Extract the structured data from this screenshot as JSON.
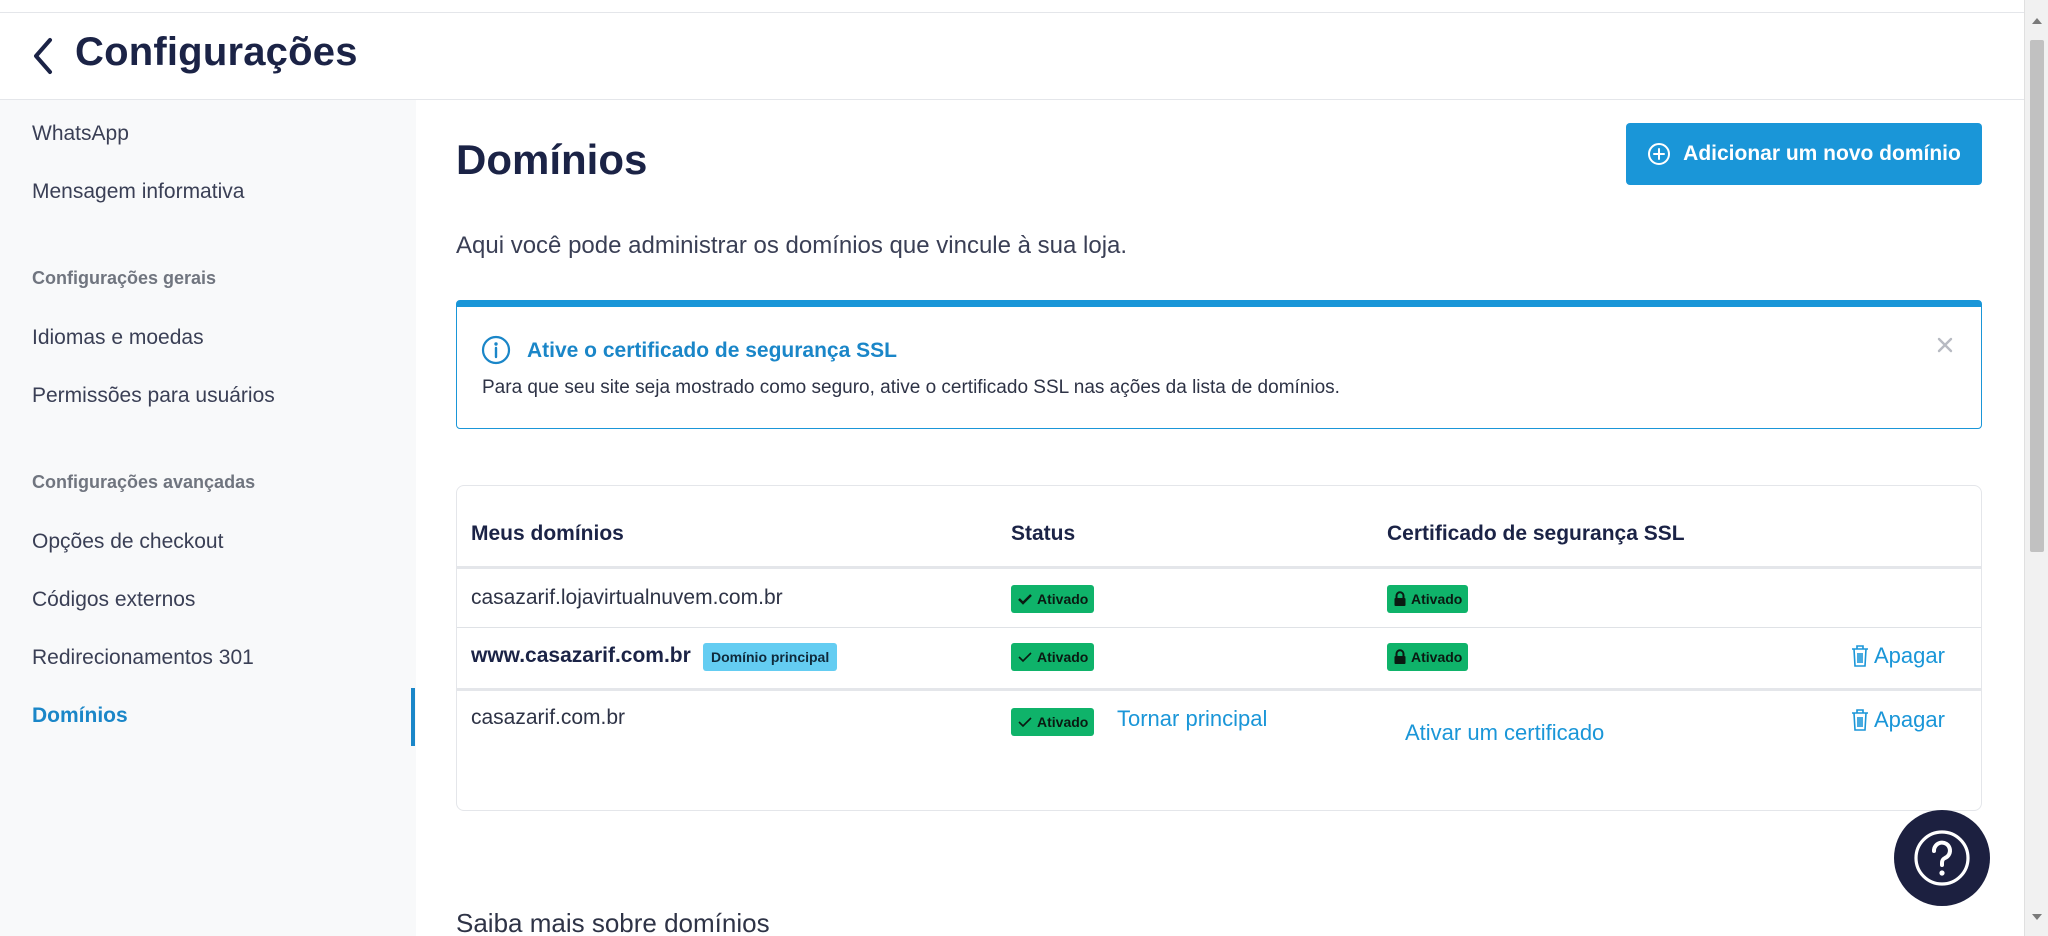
{
  "header": {
    "title": "Configurações",
    "back_icon": "chevron-left-icon"
  },
  "sidebar": {
    "items_top": [
      {
        "label": "WhatsApp"
      },
      {
        "label": "Mensagem informativa"
      }
    ],
    "section_general": "Configurações gerais",
    "items_general": [
      {
        "label": "Idiomas e moedas"
      },
      {
        "label": "Permissões para usuários"
      }
    ],
    "section_advanced": "Configurações avançadas",
    "items_advanced": [
      {
        "label": "Opções de checkout"
      },
      {
        "label": "Códigos externos"
      },
      {
        "label": "Redirecionamentos 301"
      },
      {
        "label": "Domínios",
        "active": true
      }
    ]
  },
  "main": {
    "title": "Domínios",
    "add_button": "Adicionar um novo domínio",
    "intro": "Aqui você pode administrar os domínios que vincule à sua loja.",
    "alert": {
      "title": "Ative o certificado de segurança SSL",
      "text": "Para que seu site seja mostrado como seguro, ative o certificado SSL nas ações da lista de domínios."
    },
    "table": {
      "headers": [
        "Meus domínios",
        "Status",
        "Certificado de segurança SSL"
      ],
      "rows": [
        {
          "domain": "casazarif.lojavirtualnuvem.com.br",
          "status": "Ativado",
          "ssl": "Ativado"
        },
        {
          "domain": "www.casazarif.com.br",
          "tag": "Domínio principal",
          "status": "Ativado",
          "ssl": "Ativado",
          "action": "Apagar"
        },
        {
          "domain": "casazarif.com.br",
          "status": "Ativado",
          "status_action": "Tornar principal",
          "ssl_action": "Ativar um certificado",
          "action": "Apagar"
        }
      ]
    },
    "more": "Saiba mais sobre domínios"
  },
  "colors": {
    "accent": "#1a96d8",
    "success": "#0fb36a",
    "dark": "#1c2040"
  }
}
